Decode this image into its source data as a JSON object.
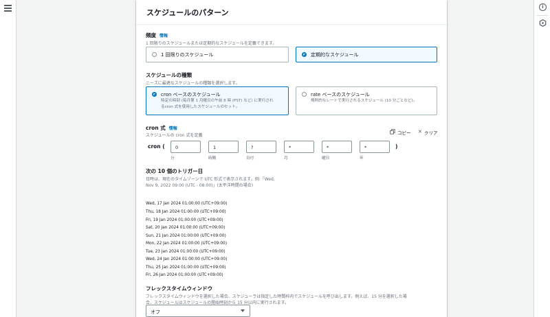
{
  "panel": {
    "title": "スケジュールのパターン"
  },
  "frequency": {
    "label": "頻度",
    "info": "情報",
    "description": "1 回限りのスケジュールまたは定期的なスケジュールを定義できます。",
    "options": [
      {
        "label": "1 回限りのスケジュール",
        "selected": false
      },
      {
        "label": "定期的なスケジュール",
        "selected": true
      }
    ]
  },
  "schedule_type": {
    "label": "スケジュールの種類",
    "description": "ニーズに最適なスケジュールの種類を選択します。",
    "options": [
      {
        "label": "cron ベースのスケジュール",
        "description": "特定の時刻 (毎月第 1 月曜日の午前 8 時 (PST) など) に実行されるcron 式を使用したスケジュールのセット。",
        "selected": true
      },
      {
        "label": "rate ベースのスケジュール",
        "description": "規則的なレートで実行されるスケジュール (10 分ごとなど)。",
        "selected": false
      }
    ]
  },
  "cron": {
    "label": "cron 式",
    "info": "情報",
    "description": "スケジュールの cron 式を定義",
    "copy_label": "コピー",
    "clear_label": "クリア",
    "prefix": "cron (",
    "suffix": ")",
    "fields": [
      {
        "value": "0",
        "unit": "分"
      },
      {
        "value": "1",
        "unit": "時間"
      },
      {
        "value": "?",
        "unit": "日付"
      },
      {
        "value": "*",
        "unit": "月"
      },
      {
        "value": "*",
        "unit": "曜日"
      },
      {
        "value": "*",
        "unit": "年"
      }
    ]
  },
  "triggers": {
    "heading": "次の 10 個のトリガー日",
    "note_line1": "日時は、現在のタイムゾーンで UTC 形式で表示されます。例:「Wed,",
    "note_line2": "Nov 9, 2022 09:00 (UTC - 08:00)」(太平洋時間の場合)",
    "dates": [
      "Wed, 17 Jan 2024 01:00:00 (UTC+09:00)",
      "Thu, 18 Jan 2024 01:00:00 (UTC+09:00)",
      "Fri, 19 Jan 2024 01:00:00 (UTC+09:00)",
      "Sat, 20 Jan 2024 01:00:00 (UTC+09:00)",
      "Sun, 21 Jan 2024 01:00:00 (UTC+09:00)",
      "Mon, 22 Jan 2024 01:00:00 (UTC+09:00)",
      "Tue, 23 Jan 2024 01:00:00 (UTC+09:00)",
      "Wed, 24 Jan 2024 01:00:00 (UTC+09:00)",
      "Thu, 25 Jan 2024 01:00:00 (UTC+09:00)",
      "Fri, 26 Jan 2024 01:00:00 (UTC+09:00)"
    ]
  },
  "flex": {
    "label": "フレックスタイムウィンドウ",
    "description_line1": "フレックスタイムウィンドウを選択した場合、スケジューラは指定した時間枠内でスケジュールを呼び出します。例えば、15 分を選択した場",
    "description_line2": "合、スケジュールはスケジュールの開始時刻から 15 分以内に実行されます。",
    "value": "オフ"
  },
  "colors": {
    "accent": "#0073bb",
    "border": "#aab7b8",
    "background": "#f2f3f3"
  },
  "icons": [
    "menu-icon",
    "info-icon",
    "hexagon-icon",
    "copy-icon",
    "close-icon",
    "caret-down-icon"
  ]
}
